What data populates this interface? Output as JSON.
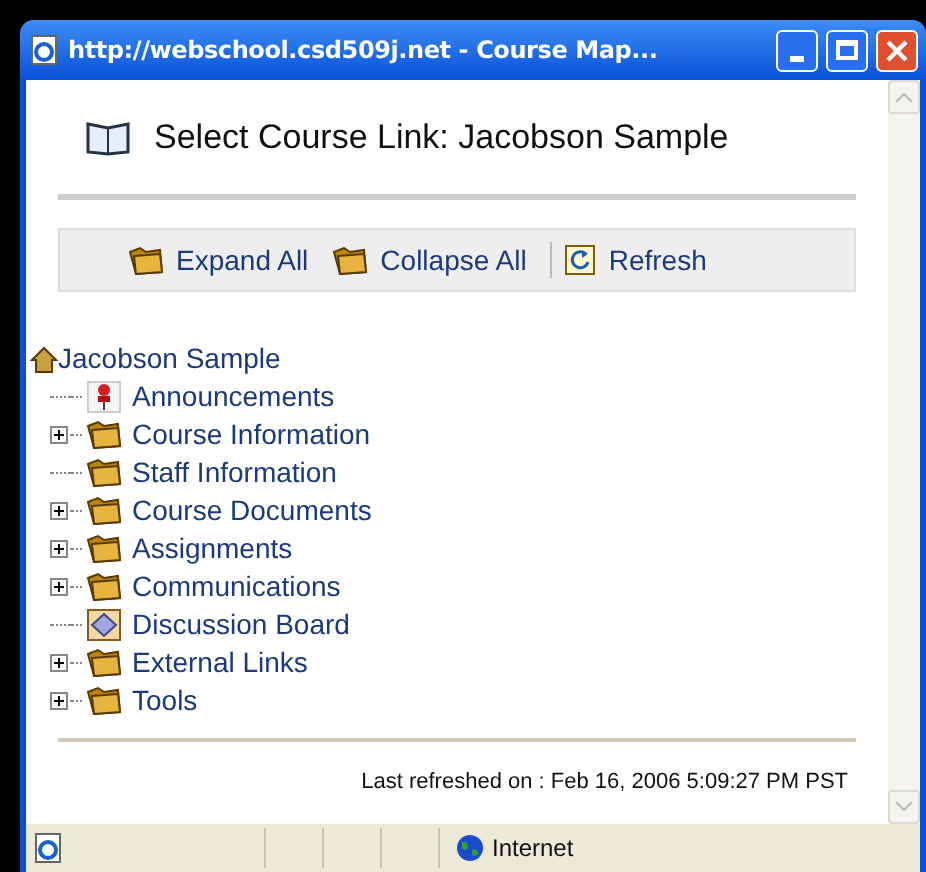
{
  "window": {
    "title": "http://webschool.csd509j.net - Course Map..."
  },
  "heading": "Select Course Link: Jacobson Sample",
  "toolbar": [
    {
      "kind": "expand",
      "label": "Expand All"
    },
    {
      "kind": "collapse",
      "label": "Collapse All"
    },
    {
      "kind": "refresh",
      "label": "Refresh"
    }
  ],
  "tree": {
    "label": "Jacobson Sample",
    "children": [
      {
        "label": "Announcements",
        "kind": "announcement",
        "expandable": false
      },
      {
        "label": "Course Information",
        "kind": "folder",
        "expandable": true
      },
      {
        "label": "Staff Information",
        "kind": "folder",
        "expandable": false
      },
      {
        "label": "Course Documents",
        "kind": "folder",
        "expandable": true
      },
      {
        "label": "Assignments",
        "kind": "folder",
        "expandable": true
      },
      {
        "label": "Communications",
        "kind": "folder",
        "expandable": true
      },
      {
        "label": "Discussion Board",
        "kind": "discussion",
        "expandable": false
      },
      {
        "label": "External Links",
        "kind": "folder",
        "expandable": true
      },
      {
        "label": "Tools",
        "kind": "folder",
        "expandable": true
      }
    ]
  },
  "footer": "Last refreshed on : Feb 16, 2006 5:09:27 PM PST",
  "status_bar": {
    "zone": "Internet"
  }
}
